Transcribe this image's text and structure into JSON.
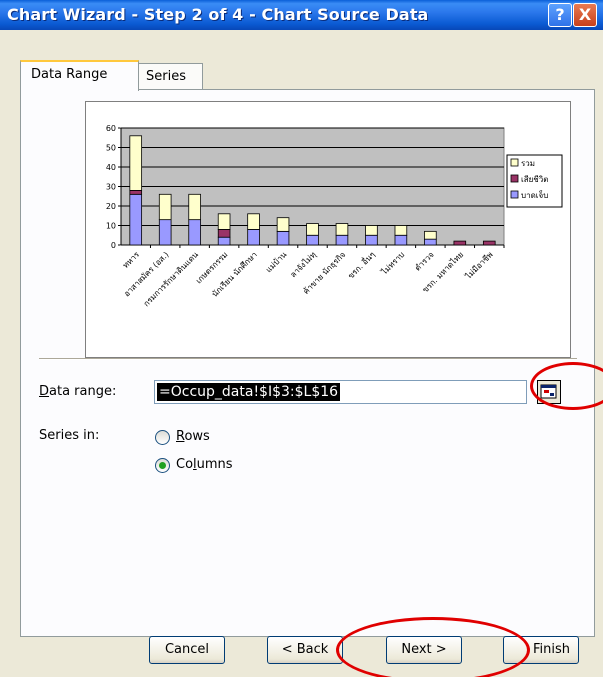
{
  "window": {
    "title": "Chart Wizard - Step 2 of 4 - Chart Source Data",
    "help_glyph": "?",
    "close_glyph": "X"
  },
  "tabs": [
    {
      "label": "Data Range",
      "active": true
    },
    {
      "label": "Series",
      "active": false
    }
  ],
  "chart_data": {
    "type": "bar",
    "stacked": true,
    "categories": [
      "ทหาร",
      "อาสาสมัคร (อส.)",
      "กรมการรักษาดินแดน",
      "เกษตรกรรม",
      "นักเรียน นักศึกษา",
      "แม่บ้าน",
      "ลาจังไม่ทุ",
      "ค้าขาย นักธุรกิจ",
      "ขรก. อื่นๆ",
      "ไม่ทราบ",
      "ตำรวจ",
      "ขรก. มหาดไทย",
      "ไม่มีอาชีพ"
    ],
    "series": [
      {
        "name": "บาดเจ็บ",
        "color": "#9999ff",
        "values": [
          26,
          13,
          13,
          4,
          8,
          7,
          5,
          5,
          5,
          5,
          3,
          0,
          0
        ]
      },
      {
        "name": "เสียชีวิต",
        "color": "#993366",
        "values": [
          2,
          0,
          0,
          4,
          0,
          0,
          0,
          0,
          0,
          0,
          0,
          2,
          2
        ]
      },
      {
        "name": "รวม",
        "color": "#ffffcc",
        "values": [
          28,
          13,
          13,
          8,
          8,
          7,
          6,
          6,
          5,
          5,
          4,
          0,
          0
        ]
      }
    ],
    "yticks": [
      "60",
      "50",
      "40",
      "30",
      "20",
      "10",
      "0"
    ],
    "ylim": [
      0,
      60
    ],
    "plot_background": "#c0c0c0",
    "grid": true,
    "legend_position": "right"
  },
  "form": {
    "data_range_label": "Data range:",
    "data_range_value": "=Occup_data!$I$3:$L$16",
    "series_in_label": "Series in:",
    "rows_label": "Rows",
    "columns_label": "Columns",
    "selected": "Columns"
  },
  "buttons": {
    "cancel": "Cancel",
    "back": "< Back",
    "next": "Next >",
    "finish": "Finish"
  },
  "annotation_color": "#e00000"
}
